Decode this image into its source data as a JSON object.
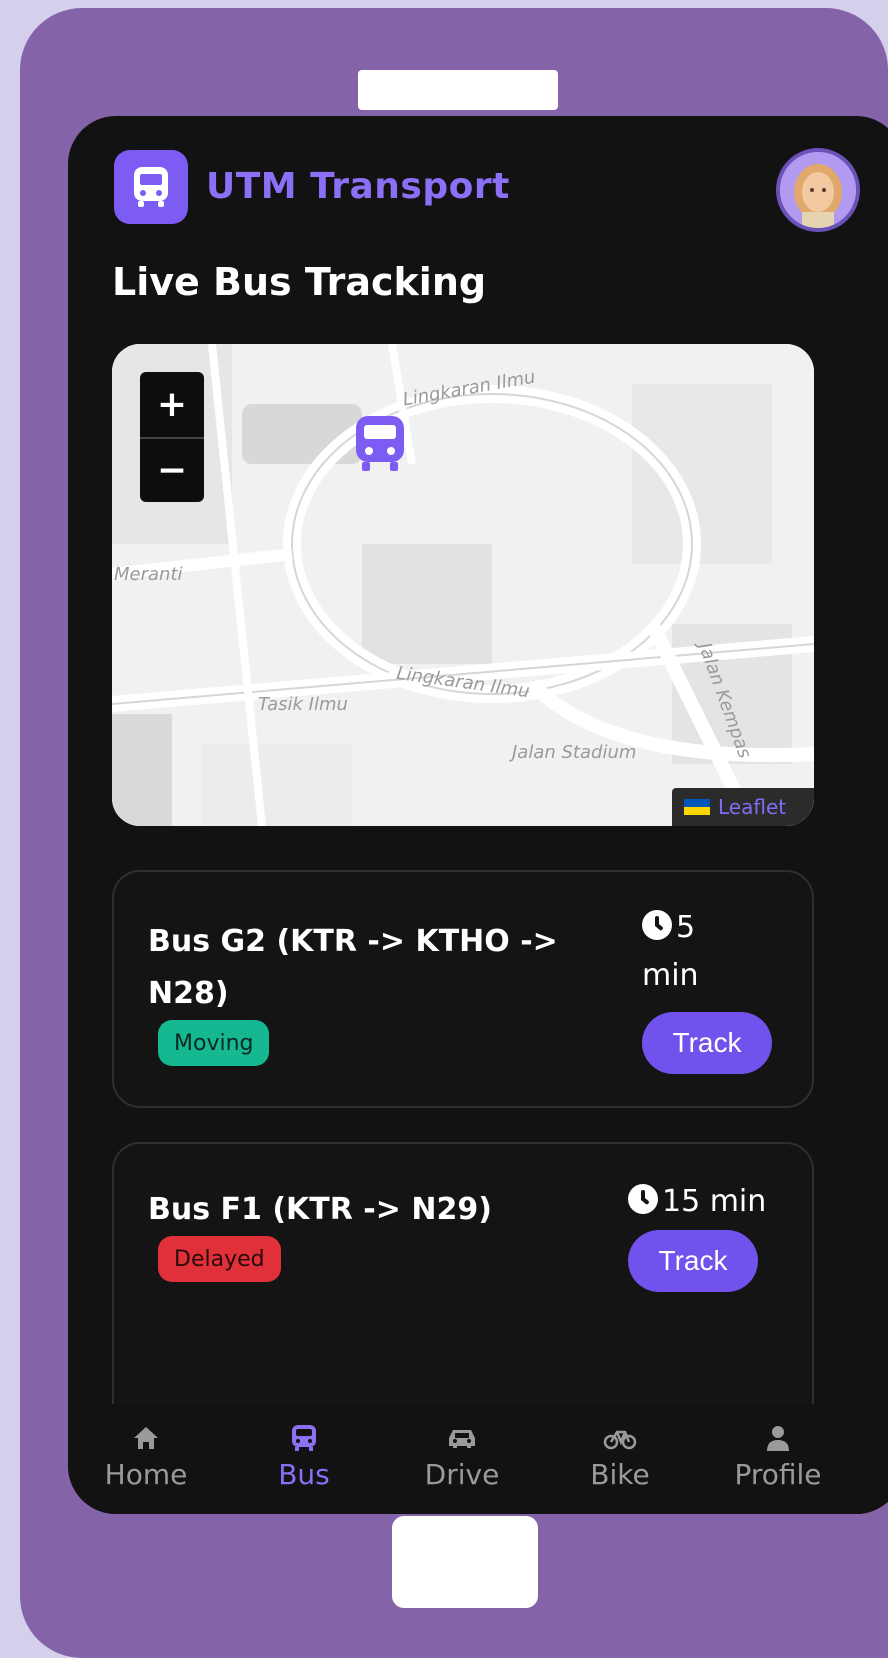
{
  "app": {
    "title": "UTM Transport"
  },
  "page": {
    "title": "Live Bus Tracking"
  },
  "map": {
    "zoom_in": "+",
    "zoom_out": "−",
    "labels": [
      "Lingkaran Ilmu",
      "Meranti",
      "Lingkaran Ilmu",
      "Tasik Ilmu",
      "Jalan Stadium",
      "Jalan Kempas"
    ],
    "attribution": "Leaflet"
  },
  "buses": [
    {
      "name": "Bus G2 (KTR -> KTHO -> N28)",
      "status": "Moving",
      "eta": "5 min",
      "action": "Track"
    },
    {
      "name": "Bus F1 (KTR -> N29)",
      "status": "Delayed",
      "eta": "15 min",
      "action": "Track"
    }
  ],
  "nav": [
    {
      "label": "Home",
      "icon": "home-icon",
      "active": false
    },
    {
      "label": "Bus",
      "icon": "bus-icon",
      "active": true
    },
    {
      "label": "Drive",
      "icon": "car-icon",
      "active": false
    },
    {
      "label": "Bike",
      "icon": "bike-icon",
      "active": false
    },
    {
      "label": "Profile",
      "icon": "user-icon",
      "active": false
    }
  ],
  "colors": {
    "accent": "#7c5cf2",
    "moving": "#15b890",
    "delayed": "#e0303a",
    "frame": "#8463a8"
  }
}
